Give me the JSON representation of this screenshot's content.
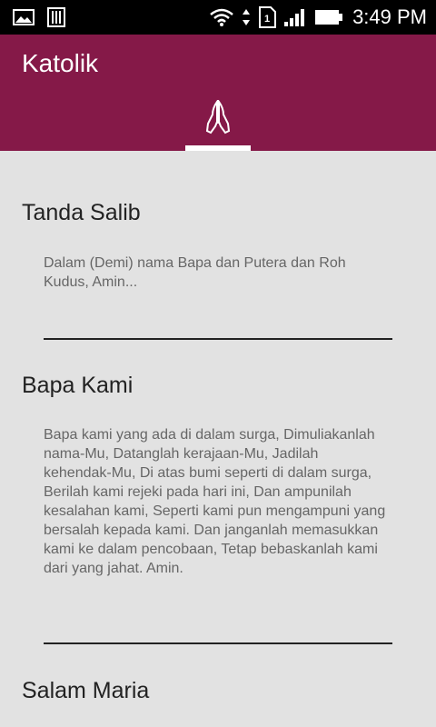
{
  "status_bar": {
    "time": "3:49 PM",
    "sim_slot": "1",
    "icons": [
      "image-icon",
      "barcode-icon",
      "wifi-icon",
      "sim-icon",
      "signal-icon",
      "battery-icon"
    ]
  },
  "app_bar": {
    "title": "Katolik",
    "background": "#851948",
    "tabs": [
      {
        "icon": "praying-hands-icon",
        "selected": true
      }
    ]
  },
  "prayers": [
    {
      "title": "Tanda Salib",
      "text": "Dalam (Demi) nama Bapa dan Putera dan Roh Kudus, Amin..."
    },
    {
      "title": "Bapa Kami",
      "text": "Bapa kami yang ada di dalam surga, Dimuliakanlah nama-Mu, Datanglah kerajaan-Mu, Jadilah kehendak-Mu, Di atas bumi seperti di dalam surga, Berilah kami rejeki pada hari ini, Dan ampunilah kesalahan kami, Seperti kami pun mengampuni yang bersalah kepada kami. Dan janganlah memasukkan kami ke dalam pencobaan, Tetap bebaskanlah kami dari yang jahat.  Amin."
    },
    {
      "title": "Salam Maria",
      "text": ""
    }
  ]
}
